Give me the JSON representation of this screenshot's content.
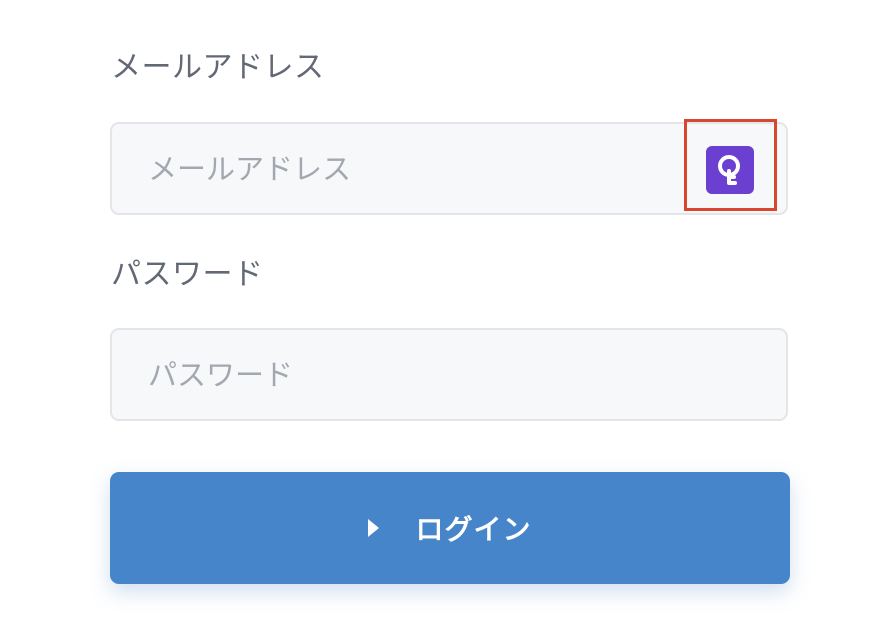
{
  "form": {
    "email": {
      "label": "メールアドレス",
      "placeholder": "メールアドレス",
      "value": ""
    },
    "password": {
      "label": "パスワード",
      "placeholder": "パスワード",
      "value": ""
    },
    "extension_icon": "key-icon",
    "login_button": {
      "label": "ログイン",
      "icon": "caret-right-icon"
    }
  },
  "colors": {
    "button": "#4685c9",
    "extension": "#6b3fd0",
    "highlight": "#d9462f"
  }
}
